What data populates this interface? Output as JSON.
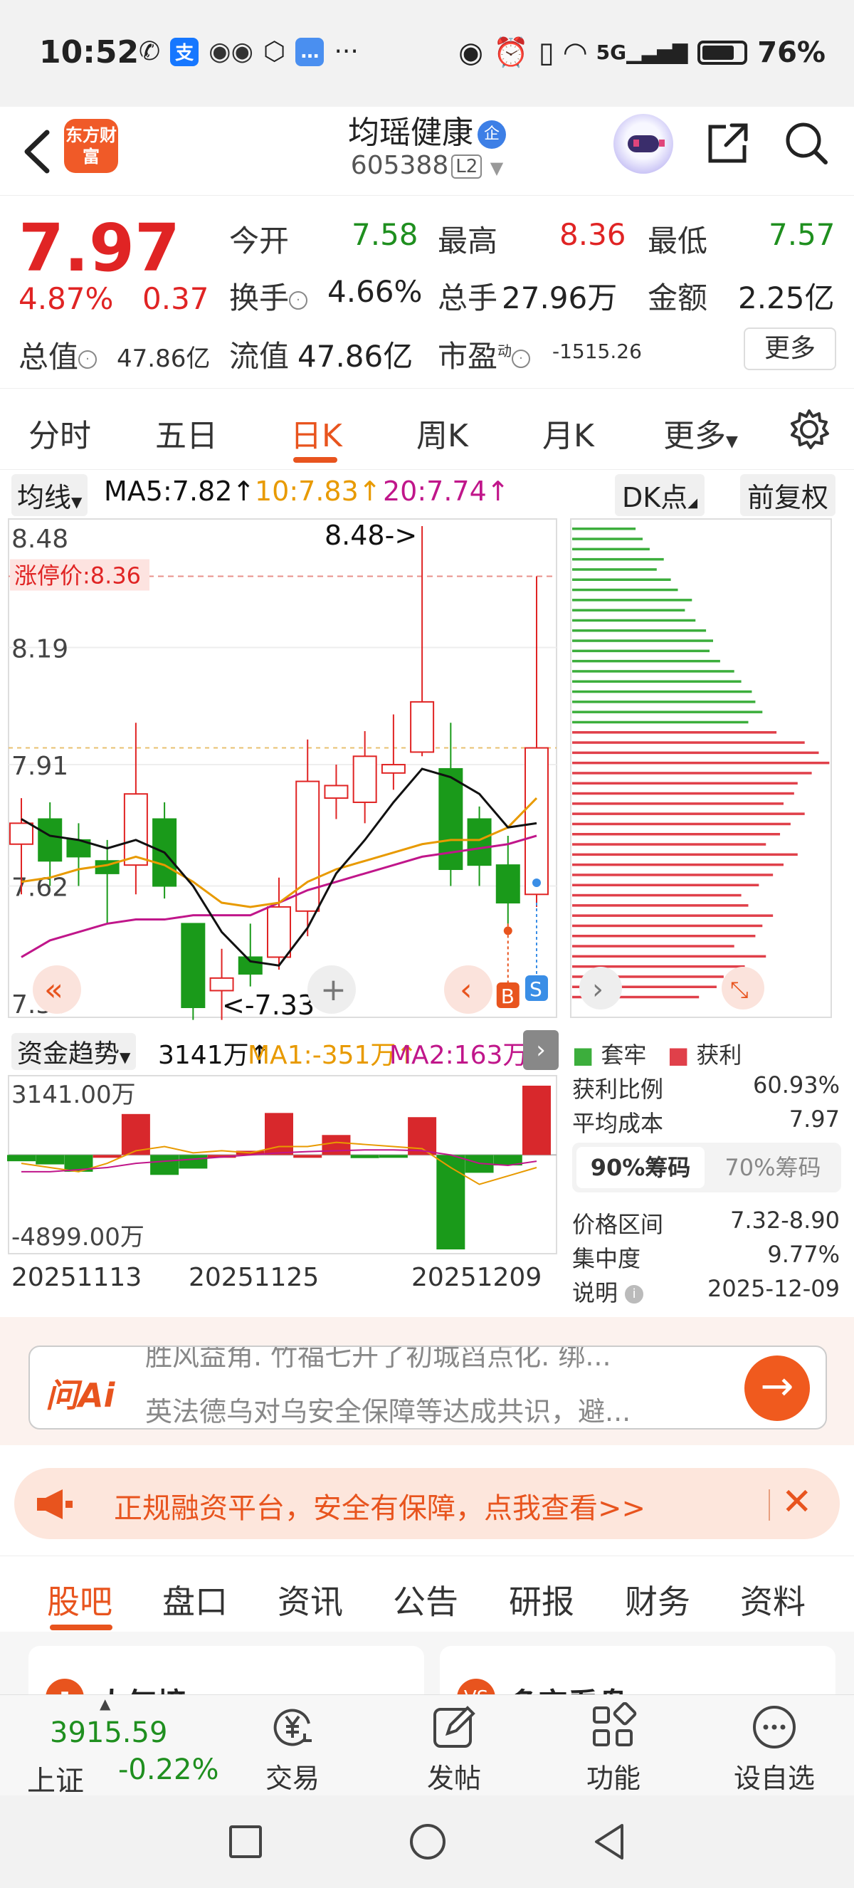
{
  "status_bar": {
    "time": "10:52",
    "battery": "76%",
    "network": "5G"
  },
  "header": {
    "logo_text": "东方财富",
    "stock_name": "均瑶健康",
    "enterprise_badge": "企",
    "stock_code": "605388",
    "level_badge": "L2"
  },
  "quote": {
    "price": "7.97",
    "pct_change": "4.87%",
    "change": "0.37",
    "open_label": "今开",
    "open": "7.58",
    "high_label": "最高",
    "high": "8.36",
    "low_label": "最低",
    "low": "7.57",
    "turnover_label": "换手",
    "turnover": "4.66%",
    "volume_label": "总手",
    "volume": "27.96万",
    "amount_label": "金额",
    "amount": "2.25亿",
    "mcap_label": "总值",
    "mcap": "47.86亿",
    "float_label": "流值",
    "float_cap": "47.86亿",
    "pe_label": "市盈",
    "pe_sup": "动",
    "pe": "-1515.26",
    "more_button": "更多"
  },
  "period_tabs": [
    "分时",
    "五日",
    "日K",
    "周K",
    "月K",
    "更多"
  ],
  "active_period": "日K",
  "ma_row": {
    "selector": "均线",
    "ma5": "MA5:7.82↑",
    "ma10": "10:7.83↑",
    "ma20": "20:7.74↑",
    "dk_button": "DK点",
    "adjust_button": "前复权",
    "ma5_color": "#111111",
    "ma10_color": "#e89a00",
    "ma20_color": "#c0168a"
  },
  "kline": {
    "y_labels": [
      "8.48",
      "8.19",
      "7.91",
      "7.62",
      "7.33"
    ],
    "limit_up_label": "涨停价:8.36",
    "high_marker": "8.48->",
    "low_marker": "<-7.33",
    "buy_marker": "B",
    "sell_marker": "S",
    "up_color": "#e02424",
    "down_color": "#1a9a1a"
  },
  "chart_data": {
    "type": "candlestick",
    "ylim": [
      7.33,
      8.48
    ],
    "limit_up": 8.36,
    "candles": [
      {
        "o": 7.72,
        "c": 7.77,
        "h": 7.83,
        "l": 7.6
      },
      {
        "o": 7.78,
        "c": 7.68,
        "h": 7.82,
        "l": 7.62
      },
      {
        "o": 7.73,
        "c": 7.69,
        "h": 7.77,
        "l": 7.62
      },
      {
        "o": 7.68,
        "c": 7.65,
        "h": 7.73,
        "l": 7.53
      },
      {
        "o": 7.67,
        "c": 7.84,
        "h": 8.01,
        "l": 7.6
      },
      {
        "o": 7.78,
        "c": 7.62,
        "h": 7.82,
        "l": 7.59
      },
      {
        "o": 7.53,
        "c": 7.33,
        "h": 7.53,
        "l": 7.3
      },
      {
        "o": 7.37,
        "c": 7.4,
        "h": 7.47,
        "l": 7.3
      },
      {
        "o": 7.45,
        "c": 7.41,
        "h": 7.53,
        "l": 7.38
      },
      {
        "o": 7.45,
        "c": 7.57,
        "h": 7.64,
        "l": 7.42
      },
      {
        "o": 7.56,
        "c": 7.87,
        "h": 7.97,
        "l": 7.5
      },
      {
        "o": 7.83,
        "c": 7.86,
        "h": 7.91,
        "l": 7.78
      },
      {
        "o": 7.82,
        "c": 7.93,
        "h": 7.99,
        "l": 7.77
      },
      {
        "o": 7.89,
        "c": 7.91,
        "h": 8.03,
        "l": 7.85
      },
      {
        "o": 7.94,
        "c": 8.06,
        "h": 8.48,
        "l": 7.93
      },
      {
        "o": 7.9,
        "c": 7.66,
        "h": 8.01,
        "l": 7.62
      },
      {
        "o": 7.78,
        "c": 7.67,
        "h": 7.81,
        "l": 7.62
      },
      {
        "o": 7.67,
        "c": 7.58,
        "h": 7.74,
        "l": 7.53
      },
      {
        "o": 7.6,
        "c": 7.95,
        "h": 8.36,
        "l": 7.57
      }
    ],
    "ma5": [
      7.78,
      7.74,
      7.73,
      7.71,
      7.73,
      7.7,
      7.62,
      7.51,
      7.44,
      7.43,
      7.52,
      7.65,
      7.73,
      7.82,
      7.9,
      7.88,
      7.84,
      7.76,
      7.77
    ],
    "ma10": [
      7.63,
      7.64,
      7.66,
      7.67,
      7.69,
      7.67,
      7.63,
      7.58,
      7.57,
      7.58,
      7.63,
      7.66,
      7.68,
      7.7,
      7.72,
      7.73,
      7.73,
      7.76,
      7.83
    ],
    "ma20": [
      7.45,
      7.49,
      7.51,
      7.53,
      7.54,
      7.54,
      7.55,
      7.55,
      7.55,
      7.58,
      7.61,
      7.63,
      7.65,
      7.67,
      7.69,
      7.7,
      7.71,
      7.72,
      7.74
    ]
  },
  "volume": {
    "selector": "资金趋势",
    "value": "3141万↑",
    "ma1": "MA1:-351万↑",
    "ma2": "MA2:163万↑",
    "y_top": "3141.00万",
    "y_bottom": "-4899.00万",
    "bars": [
      -60,
      -90,
      -160,
      0,
      390,
      -190,
      -130,
      0,
      40,
      400,
      0,
      190,
      -30,
      -20,
      360,
      -900,
      -170,
      -100,
      660
    ],
    "ylim": [
      -900,
      660
    ]
  },
  "dates": [
    "20251113",
    "20251125",
    "20251209"
  ],
  "chips": {
    "legend_trapped": "套牢",
    "legend_profit": "获利",
    "profit_ratio_label": "获利比例",
    "profit_ratio": "60.93%",
    "avg_cost_label": "平均成本",
    "avg_cost": "7.97",
    "tab_90": "90%筹码",
    "tab_70": "70%筹码",
    "range_label": "价格区间",
    "range": "7.32-8.90",
    "concentration_label": "集中度",
    "concentration": "9.77%",
    "note_label": "说明",
    "note_date": "2025-12-09",
    "profit_color": "#e0404a",
    "trapped_color": "#3cae3c"
  },
  "ai_bar": {
    "logo": "问Ai",
    "line1": "胜风益角. 竹福七开了初城舀点化. 绑...",
    "line2": "英法德乌对乌安全保障等达成共识，避..."
  },
  "promo": {
    "text": "正规融资平台，安全有保障，点我查看>>"
  },
  "bottom_tabs": [
    "股吧",
    "盘口",
    "资讯",
    "公告",
    "研报",
    "财务",
    "资料"
  ],
  "cards": {
    "left_title": "人气榜",
    "right_title": "多空看盘",
    "right_icon": "VS"
  },
  "bottom_nav": {
    "index_value": "3915.59",
    "index_name": "上证",
    "index_pct": "-0.22%",
    "trade": "交易",
    "post": "发帖",
    "functions": "功能",
    "watchlist": "设自选"
  }
}
